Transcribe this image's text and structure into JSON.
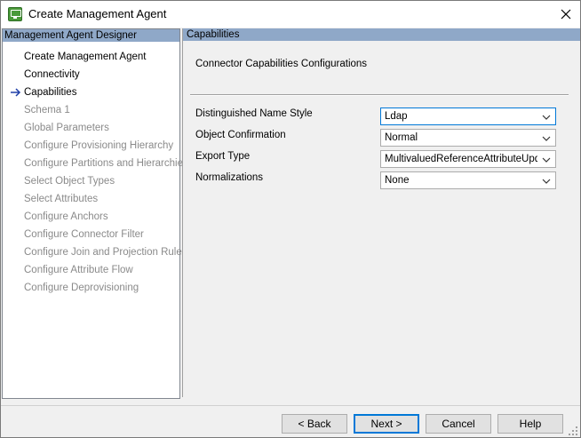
{
  "window": {
    "title": "Create Management Agent"
  },
  "left_panel": {
    "header": "Management Agent Designer",
    "items": [
      {
        "label": "Create Management Agent",
        "enabled": true,
        "current": false
      },
      {
        "label": "Connectivity",
        "enabled": true,
        "current": false
      },
      {
        "label": "Capabilities",
        "enabled": true,
        "current": true
      },
      {
        "label": "Schema 1",
        "enabled": false,
        "current": false
      },
      {
        "label": "Global Parameters",
        "enabled": false,
        "current": false
      },
      {
        "label": "Configure Provisioning Hierarchy",
        "enabled": false,
        "current": false
      },
      {
        "label": "Configure Partitions and Hierarchies",
        "enabled": false,
        "current": false
      },
      {
        "label": "Select Object Types",
        "enabled": false,
        "current": false
      },
      {
        "label": "Select Attributes",
        "enabled": false,
        "current": false
      },
      {
        "label": "Configure Anchors",
        "enabled": false,
        "current": false
      },
      {
        "label": "Configure Connector Filter",
        "enabled": false,
        "current": false
      },
      {
        "label": "Configure Join and Projection Rules",
        "enabled": false,
        "current": false
      },
      {
        "label": "Configure Attribute Flow",
        "enabled": false,
        "current": false
      },
      {
        "label": "Configure Deprovisioning",
        "enabled": false,
        "current": false
      }
    ]
  },
  "right_panel": {
    "header": "Capabilities",
    "section_title": "Connector Capabilities Configurations",
    "fields": [
      {
        "label": "Distinguished Name Style",
        "value": "Ldap",
        "focused": true
      },
      {
        "label": "Object Confirmation",
        "value": "Normal",
        "focused": false
      },
      {
        "label": "Export Type",
        "value": "MultivaluedReferenceAttributeUpdate",
        "focused": false
      },
      {
        "label": "Normalizations",
        "value": "None",
        "focused": false
      }
    ]
  },
  "buttons": {
    "back": "< Back",
    "next": "Next >",
    "cancel": "Cancel",
    "help": "Help"
  },
  "colors": {
    "header_bg": "#8fa8c8",
    "accent": "#0078d7",
    "arrow": "#1f3fa8",
    "disabled_text": "#8a8a8a"
  },
  "icons": {
    "app": "management-agent-icon",
    "close": "close-icon",
    "current_step": "arrow-right-icon",
    "dropdown": "chevron-down-icon"
  }
}
